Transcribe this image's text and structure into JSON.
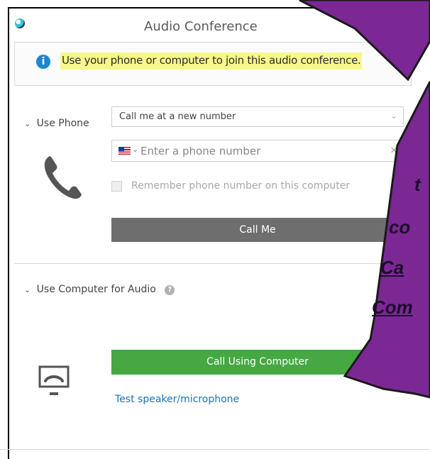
{
  "window": {
    "title": "Audio Conference"
  },
  "banner": {
    "text": "Use your phone or computer to join this audio conference."
  },
  "phone_section": {
    "label": "Use Phone",
    "select_value": "Call me at a new number",
    "phone_placeholder": "Enter a phone number",
    "remember_label": "Remember phone number on this computer",
    "call_me_label": "Call Me"
  },
  "computer_section": {
    "label": "Use Computer for Audio",
    "call_button_label": "Call Using Computer",
    "test_link": "Test speaker/microphone"
  },
  "callout": {
    "fragments": [
      "t",
      "co",
      "Ca",
      "Com"
    ]
  },
  "colors": {
    "overlay_purple": "#7b2894",
    "highlight_yellow": "#f8f78b",
    "call_green": "#46a843",
    "call_gray": "#6e6e6e",
    "link_blue": "#1b74b5"
  }
}
